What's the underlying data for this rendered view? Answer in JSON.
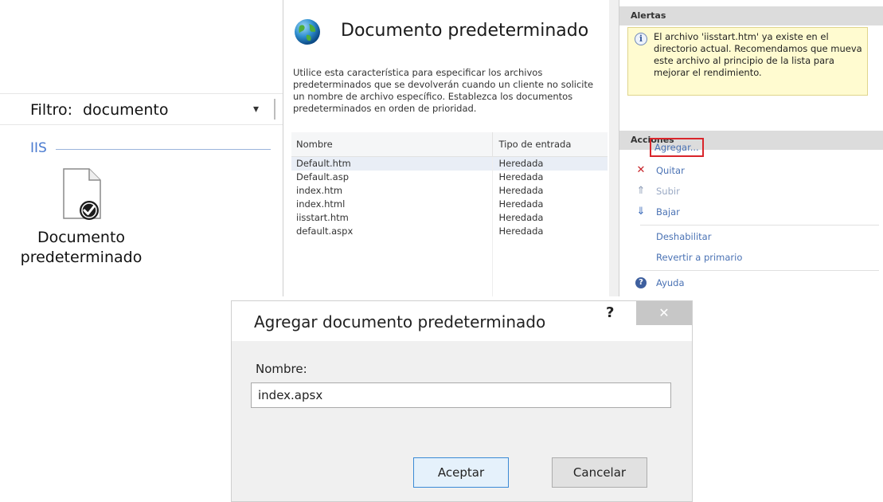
{
  "left_panel": {
    "filter_label": "Filtro:",
    "filter_value": "documento",
    "filter_dropdown_glyph": "▾",
    "group_label": "IIS",
    "feature_icon": "document-check-icon",
    "feature_label": "Documento predeterminado"
  },
  "middle_panel": {
    "icon": "globe-icon",
    "title": "Documento predeterminado",
    "description": "Utilice esta característica para especificar los archivos predeterminados que se devolverán cuando un cliente no solicite un nombre de archivo específico. Establezca los documentos predeterminados en orden de prioridad.",
    "columns": [
      "Nombre",
      "Tipo de entrada"
    ],
    "rows": [
      {
        "name": "Default.htm",
        "type": "Heredada"
      },
      {
        "name": "Default.asp",
        "type": "Heredada"
      },
      {
        "name": "index.htm",
        "type": "Heredada"
      },
      {
        "name": "index.html",
        "type": "Heredada"
      },
      {
        "name": "iisstart.htm",
        "type": "Heredada"
      },
      {
        "name": "default.aspx",
        "type": "Heredada"
      }
    ]
  },
  "right_panel": {
    "alerts_header": "Alertas",
    "alert_icon": "info-icon",
    "alert_text": "El archivo 'iisstart.htm' ya existe en el directorio actual. Recomendamos que mueva este archivo al principio de la lista para mejorar el rendimiento.",
    "actions_header": "Acciones",
    "actions": {
      "add": "Agregar...",
      "remove": "Quitar",
      "up": "Subir",
      "down": "Bajar",
      "disable": "Deshabilitar",
      "revert": "Revertir a primario",
      "help": "Ayuda"
    },
    "action_glyphs": {
      "remove": "✕",
      "up": "⇑",
      "down": "⇓",
      "help": "?"
    }
  },
  "dialog": {
    "title": "Agregar documento predeterminado",
    "help_glyph": "?",
    "close_glyph": "✕",
    "field_label": "Nombre:",
    "field_value": "index.apsx",
    "ok_label": "Aceptar",
    "cancel_label": "Cancelar"
  },
  "colors": {
    "accent_link": "#4a72b4",
    "highlight_border": "#d9252b",
    "alert_background": "#fffbd0",
    "group_label": "#4a7bd0"
  }
}
